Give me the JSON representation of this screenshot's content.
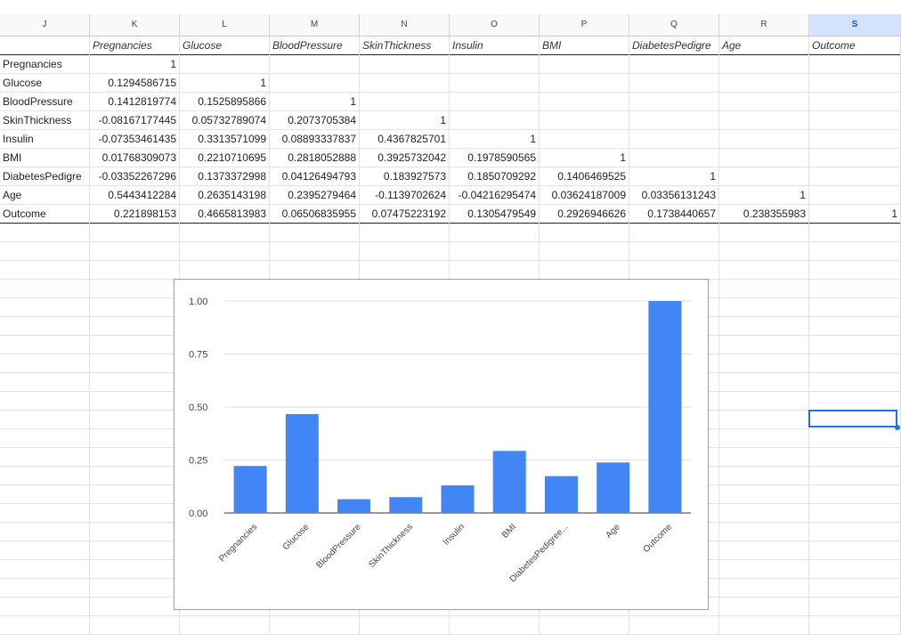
{
  "columns": [
    {
      "letter": "J",
      "selected": false
    },
    {
      "letter": "K",
      "selected": false
    },
    {
      "letter": "L",
      "selected": false
    },
    {
      "letter": "M",
      "selected": false
    },
    {
      "letter": "N",
      "selected": false
    },
    {
      "letter": "O",
      "selected": false
    },
    {
      "letter": "P",
      "selected": false
    },
    {
      "letter": "Q",
      "selected": false
    },
    {
      "letter": "R",
      "selected": false
    },
    {
      "letter": "S",
      "selected": true
    }
  ],
  "table": {
    "header": [
      "",
      "Pregnancies",
      "Glucose",
      "BloodPressure",
      "SkinThickness",
      "Insulin",
      "BMI",
      "DiabetesPedigre",
      "Age",
      "Outcome"
    ],
    "rows": [
      [
        "Pregnancies",
        "1",
        "",
        "",
        "",
        "",
        "",
        "",
        "",
        ""
      ],
      [
        "Glucose",
        "0.1294586715",
        "1",
        "",
        "",
        "",
        "",
        "",
        "",
        ""
      ],
      [
        "BloodPressure",
        "0.1412819774",
        "0.1525895866",
        "1",
        "",
        "",
        "",
        "",
        "",
        ""
      ],
      [
        "SkinThickness",
        "-0.08167177445",
        "0.05732789074",
        "0.2073705384",
        "1",
        "",
        "",
        "",
        "",
        ""
      ],
      [
        "Insulin",
        "-0.07353461435",
        "0.3313571099",
        "0.08893337837",
        "0.4367825701",
        "1",
        "",
        "",
        "",
        ""
      ],
      [
        "BMI",
        "0.01768309073",
        "0.2210710695",
        "0.2818052888",
        "0.3925732042",
        "0.1978590565",
        "1",
        "",
        "",
        ""
      ],
      [
        "DiabetesPedigre",
        "-0.03352267296",
        "0.1373372998",
        "0.04126494793",
        "0.183927573",
        "0.1850709292",
        "0.1406469525",
        "1",
        "",
        ""
      ],
      [
        "Age",
        "0.5443412284",
        "0.2635143198",
        "0.2395279464",
        "-0.1139702624",
        "-0.04216295474",
        "0.03624187009",
        "0.03356131243",
        "1",
        ""
      ],
      [
        "Outcome",
        "0.221898153",
        "0.4665813983",
        "0.06506835955",
        "0.07475223192",
        "0.1305479549",
        "0.2926946626",
        "0.1738440657",
        "0.238355983",
        "1"
      ]
    ]
  },
  "chart_data": {
    "type": "bar",
    "categories": [
      "Pregnancies",
      "Glucose",
      "BloodPressure",
      "SkinThickness",
      "Insulin",
      "BMI",
      "DiabetesPedigree...",
      "Age",
      "Outcome"
    ],
    "values": [
      0.221898153,
      0.4665813983,
      0.06506835955,
      0.07475223192,
      0.1305479549,
      0.2926946626,
      0.1738440657,
      0.238355983,
      1
    ],
    "ylim": [
      0,
      1
    ],
    "yticks": [
      "0.00",
      "0.25",
      "0.50",
      "0.75",
      "1.00"
    ],
    "bar_color": "#4285f4",
    "grid": true,
    "title": "",
    "xlabel": "",
    "ylabel": ""
  },
  "colors": {
    "accent": "#1a73e8",
    "selected_header_bg": "#d3e3fd"
  }
}
